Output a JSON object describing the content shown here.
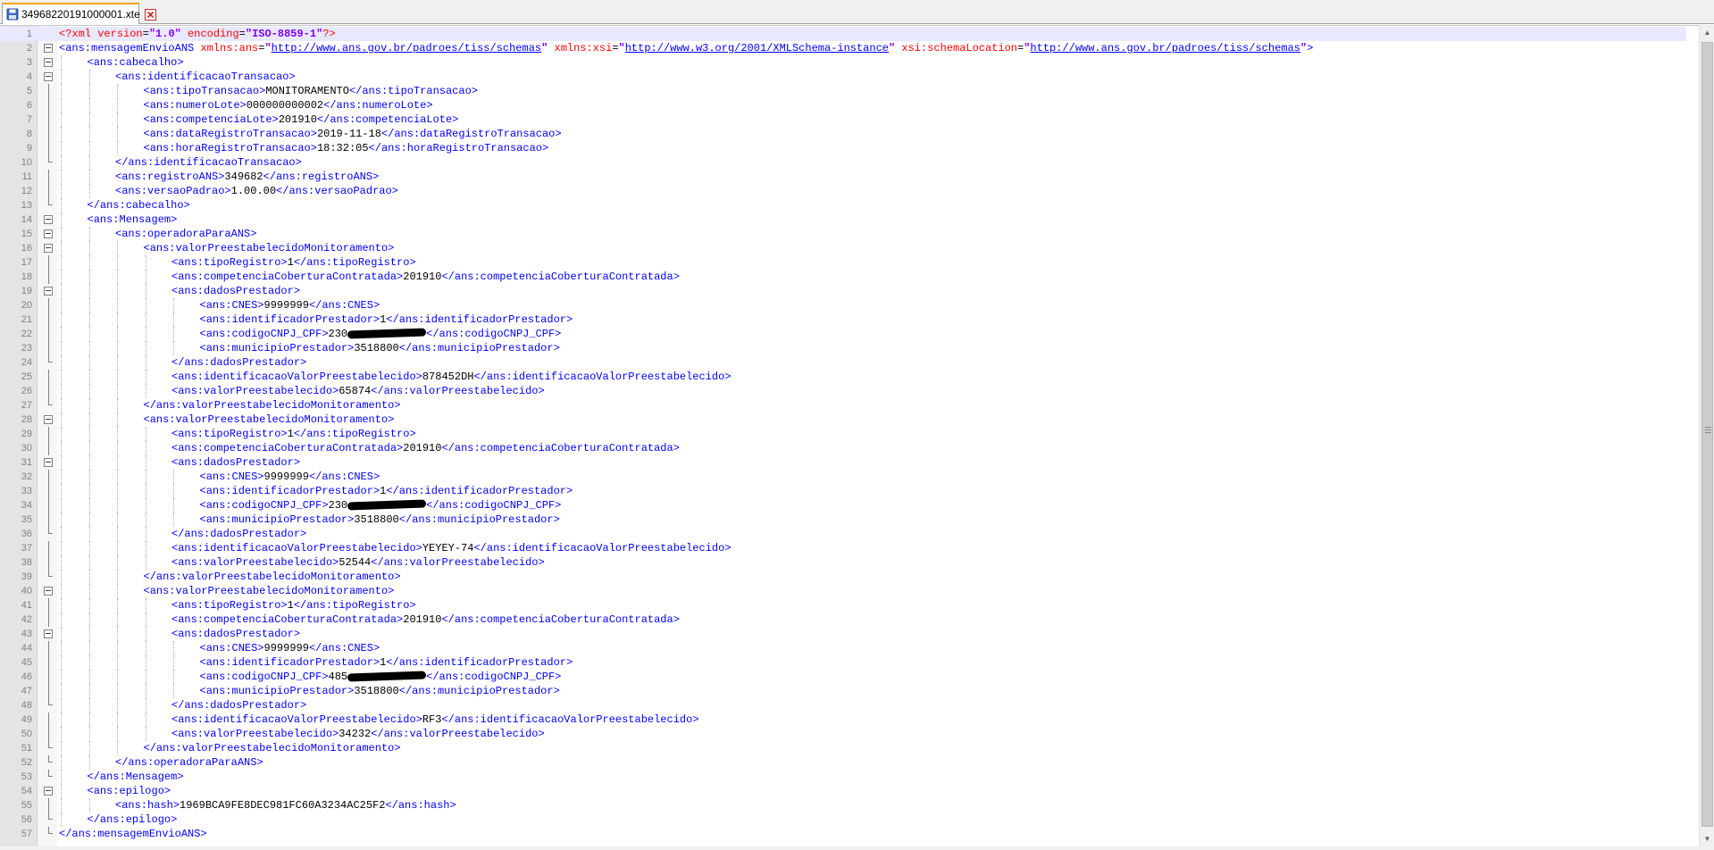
{
  "tab": {
    "filename": "34968220191000001.xte"
  },
  "current_line": 1,
  "lines": [
    {
      "n": "1",
      "indent": 0,
      "fold": "none",
      "segs": [
        [
          "p",
          "<?xml "
        ],
        [
          "a",
          "version"
        ],
        [
          "x",
          "="
        ],
        [
          "v",
          "\"1.0\""
        ],
        [
          "a",
          " encoding"
        ],
        [
          "x",
          "="
        ],
        [
          "v",
          "\"ISO-8859-1\""
        ],
        [
          "p",
          "?>"
        ]
      ]
    },
    {
      "n": "2",
      "indent": 0,
      "fold": "open",
      "segs": [
        [
          "t",
          "<ans:mensagemEnvioANS "
        ],
        [
          "a",
          "xmlns:ans"
        ],
        [
          "x",
          "="
        ],
        [
          "v",
          "\""
        ],
        [
          "u",
          "http://www.ans.gov.br/padroes/tiss/schemas"
        ],
        [
          "v",
          "\""
        ],
        [
          "a",
          " xmlns:xsi"
        ],
        [
          "x",
          "="
        ],
        [
          "v",
          "\""
        ],
        [
          "u",
          "http://www.w3.org/2001/XMLSchema-instance"
        ],
        [
          "v",
          "\""
        ],
        [
          "a",
          " xsi:schemaLocation"
        ],
        [
          "x",
          "="
        ],
        [
          "v",
          "\""
        ],
        [
          "u",
          "http://www.ans.gov.br/padroes/tiss/schemas"
        ],
        [
          "v",
          "\""
        ],
        [
          "t",
          ">"
        ]
      ]
    },
    {
      "n": "3",
      "indent": 1,
      "fold": "open",
      "segs": [
        [
          "t",
          "<ans:cabecalho>"
        ]
      ]
    },
    {
      "n": "4",
      "indent": 2,
      "fold": "open",
      "segs": [
        [
          "t",
          "<ans:identificacaoTransacao>"
        ]
      ]
    },
    {
      "n": "5",
      "indent": 3,
      "fold": "line",
      "segs": [
        [
          "t",
          "<ans:tipoTransacao>"
        ],
        [
          "x",
          "MONITORAMENTO"
        ],
        [
          "t",
          "</ans:tipoTransacao>"
        ]
      ]
    },
    {
      "n": "6",
      "indent": 3,
      "fold": "line",
      "segs": [
        [
          "t",
          "<ans:numeroLote>"
        ],
        [
          "x",
          "000000000002"
        ],
        [
          "t",
          "</ans:numeroLote>"
        ]
      ]
    },
    {
      "n": "7",
      "indent": 3,
      "fold": "line",
      "segs": [
        [
          "t",
          "<ans:competenciaLote>"
        ],
        [
          "x",
          "201910"
        ],
        [
          "t",
          "</ans:competenciaLote>"
        ]
      ]
    },
    {
      "n": "8",
      "indent": 3,
      "fold": "line",
      "segs": [
        [
          "t",
          "<ans:dataRegistroTransacao>"
        ],
        [
          "x",
          "2019-11-18"
        ],
        [
          "t",
          "</ans:dataRegistroTransacao>"
        ]
      ]
    },
    {
      "n": "9",
      "indent": 3,
      "fold": "line",
      "segs": [
        [
          "t",
          "<ans:horaRegistroTransacao>"
        ],
        [
          "x",
          "18:32:05"
        ],
        [
          "t",
          "</ans:horaRegistroTransacao>"
        ]
      ]
    },
    {
      "n": "10",
      "indent": 2,
      "fold": "end",
      "segs": [
        [
          "t",
          "</ans:identificacaoTransacao>"
        ]
      ]
    },
    {
      "n": "11",
      "indent": 2,
      "fold": "line",
      "segs": [
        [
          "t",
          "<ans:registroANS>"
        ],
        [
          "x",
          "349682"
        ],
        [
          "t",
          "</ans:registroANS>"
        ]
      ]
    },
    {
      "n": "12",
      "indent": 2,
      "fold": "line",
      "segs": [
        [
          "t",
          "<ans:versaoPadrao>"
        ],
        [
          "x",
          "1.00.00"
        ],
        [
          "t",
          "</ans:versaoPadrao>"
        ]
      ]
    },
    {
      "n": "13",
      "indent": 1,
      "fold": "end",
      "segs": [
        [
          "t",
          "</ans:cabecalho>"
        ]
      ]
    },
    {
      "n": "14",
      "indent": 1,
      "fold": "open",
      "segs": [
        [
          "t",
          "<ans:Mensagem>"
        ]
      ]
    },
    {
      "n": "15",
      "indent": 2,
      "fold": "open",
      "segs": [
        [
          "t",
          "<ans:operadoraParaANS>"
        ]
      ]
    },
    {
      "n": "16",
      "indent": 3,
      "fold": "open",
      "segs": [
        [
          "t",
          "<ans:valorPreestabelecidoMonitoramento>"
        ]
      ]
    },
    {
      "n": "17",
      "indent": 4,
      "fold": "line",
      "segs": [
        [
          "t",
          "<ans:tipoRegistro>"
        ],
        [
          "x",
          "1"
        ],
        [
          "t",
          "</ans:tipoRegistro>"
        ]
      ]
    },
    {
      "n": "18",
      "indent": 4,
      "fold": "line",
      "segs": [
        [
          "t",
          "<ans:competenciaCoberturaContratada>"
        ],
        [
          "x",
          "201910"
        ],
        [
          "t",
          "</ans:competenciaCoberturaContratada>"
        ]
      ]
    },
    {
      "n": "19",
      "indent": 4,
      "fold": "open",
      "segs": [
        [
          "t",
          "<ans:dadosPrestador>"
        ]
      ]
    },
    {
      "n": "20",
      "indent": 5,
      "fold": "line",
      "segs": [
        [
          "t",
          "<ans:CNES>"
        ],
        [
          "x",
          "9999999"
        ],
        [
          "t",
          "</ans:CNES>"
        ]
      ]
    },
    {
      "n": "21",
      "indent": 5,
      "fold": "line",
      "segs": [
        [
          "t",
          "<ans:identificadorPrestador>"
        ],
        [
          "x",
          "1"
        ],
        [
          "t",
          "</ans:identificadorPrestador>"
        ]
      ]
    },
    {
      "n": "22",
      "indent": 5,
      "fold": "line",
      "segs": [
        [
          "t",
          "<ans:codigoCNPJ_CPF>"
        ],
        [
          "x",
          "230"
        ],
        [
          "r",
          ""
        ],
        [
          "t",
          "</ans:codigoCNPJ_CPF>"
        ]
      ]
    },
    {
      "n": "23",
      "indent": 5,
      "fold": "line",
      "segs": [
        [
          "t",
          "<ans:municipioPrestador>"
        ],
        [
          "x",
          "3518800"
        ],
        [
          "t",
          "</ans:municipioPrestador>"
        ]
      ]
    },
    {
      "n": "24",
      "indent": 4,
      "fold": "end",
      "segs": [
        [
          "t",
          "</ans:dadosPrestador>"
        ]
      ]
    },
    {
      "n": "25",
      "indent": 4,
      "fold": "line",
      "segs": [
        [
          "t",
          "<ans:identificacaoValorPreestabelecido>"
        ],
        [
          "x",
          "878452DH"
        ],
        [
          "t",
          "</ans:identificacaoValorPreestabelecido>"
        ]
      ]
    },
    {
      "n": "26",
      "indent": 4,
      "fold": "line",
      "segs": [
        [
          "t",
          "<ans:valorPreestabelecido>"
        ],
        [
          "x",
          "65874"
        ],
        [
          "t",
          "</ans:valorPreestabelecido>"
        ]
      ]
    },
    {
      "n": "27",
      "indent": 3,
      "fold": "end",
      "segs": [
        [
          "t",
          "</ans:valorPreestabelecidoMonitoramento>"
        ]
      ]
    },
    {
      "n": "28",
      "indent": 3,
      "fold": "open",
      "segs": [
        [
          "t",
          "<ans:valorPreestabelecidoMonitoramento>"
        ]
      ]
    },
    {
      "n": "29",
      "indent": 4,
      "fold": "line",
      "segs": [
        [
          "t",
          "<ans:tipoRegistro>"
        ],
        [
          "x",
          "1"
        ],
        [
          "t",
          "</ans:tipoRegistro>"
        ]
      ]
    },
    {
      "n": "30",
      "indent": 4,
      "fold": "line",
      "segs": [
        [
          "t",
          "<ans:competenciaCoberturaContratada>"
        ],
        [
          "x",
          "201910"
        ],
        [
          "t",
          "</ans:competenciaCoberturaContratada>"
        ]
      ]
    },
    {
      "n": "31",
      "indent": 4,
      "fold": "open",
      "segs": [
        [
          "t",
          "<ans:dadosPrestador>"
        ]
      ]
    },
    {
      "n": "32",
      "indent": 5,
      "fold": "line",
      "segs": [
        [
          "t",
          "<ans:CNES>"
        ],
        [
          "x",
          "9999999"
        ],
        [
          "t",
          "</ans:CNES>"
        ]
      ]
    },
    {
      "n": "33",
      "indent": 5,
      "fold": "line",
      "segs": [
        [
          "t",
          "<ans:identificadorPrestador>"
        ],
        [
          "x",
          "1"
        ],
        [
          "t",
          "</ans:identificadorPrestador>"
        ]
      ]
    },
    {
      "n": "34",
      "indent": 5,
      "fold": "line",
      "segs": [
        [
          "t",
          "<ans:codigoCNPJ_CPF>"
        ],
        [
          "x",
          "230"
        ],
        [
          "r",
          ""
        ],
        [
          "t",
          "</ans:codigoCNPJ_CPF>"
        ]
      ]
    },
    {
      "n": "35",
      "indent": 5,
      "fold": "line",
      "segs": [
        [
          "t",
          "<ans:municipioPrestador>"
        ],
        [
          "x",
          "3518800"
        ],
        [
          "t",
          "</ans:municipioPrestador>"
        ]
      ]
    },
    {
      "n": "36",
      "indent": 4,
      "fold": "end",
      "segs": [
        [
          "t",
          "</ans:dadosPrestador>"
        ]
      ]
    },
    {
      "n": "37",
      "indent": 4,
      "fold": "line",
      "segs": [
        [
          "t",
          "<ans:identificacaoValorPreestabelecido>"
        ],
        [
          "x",
          "YEYEY-74"
        ],
        [
          "t",
          "</ans:identificacaoValorPreestabelecido>"
        ]
      ]
    },
    {
      "n": "38",
      "indent": 4,
      "fold": "line",
      "segs": [
        [
          "t",
          "<ans:valorPreestabelecido>"
        ],
        [
          "x",
          "52544"
        ],
        [
          "t",
          "</ans:valorPreestabelecido>"
        ]
      ]
    },
    {
      "n": "39",
      "indent": 3,
      "fold": "end",
      "segs": [
        [
          "t",
          "</ans:valorPreestabelecidoMonitoramento>"
        ]
      ]
    },
    {
      "n": "40",
      "indent": 3,
      "fold": "open",
      "segs": [
        [
          "t",
          "<ans:valorPreestabelecidoMonitoramento>"
        ]
      ]
    },
    {
      "n": "41",
      "indent": 4,
      "fold": "line",
      "segs": [
        [
          "t",
          "<ans:tipoRegistro>"
        ],
        [
          "x",
          "1"
        ],
        [
          "t",
          "</ans:tipoRegistro>"
        ]
      ]
    },
    {
      "n": "42",
      "indent": 4,
      "fold": "line",
      "segs": [
        [
          "t",
          "<ans:competenciaCoberturaContratada>"
        ],
        [
          "x",
          "201910"
        ],
        [
          "t",
          "</ans:competenciaCoberturaContratada>"
        ]
      ]
    },
    {
      "n": "43",
      "indent": 4,
      "fold": "open",
      "segs": [
        [
          "t",
          "<ans:dadosPrestador>"
        ]
      ]
    },
    {
      "n": "44",
      "indent": 5,
      "fold": "line",
      "segs": [
        [
          "t",
          "<ans:CNES>"
        ],
        [
          "x",
          "9999999"
        ],
        [
          "t",
          "</ans:CNES>"
        ]
      ]
    },
    {
      "n": "45",
      "indent": 5,
      "fold": "line",
      "segs": [
        [
          "t",
          "<ans:identificadorPrestador>"
        ],
        [
          "x",
          "1"
        ],
        [
          "t",
          "</ans:identificadorPrestador>"
        ]
      ]
    },
    {
      "n": "46",
      "indent": 5,
      "fold": "line",
      "segs": [
        [
          "t",
          "<ans:codigoCNPJ_CPF>"
        ],
        [
          "x",
          "485"
        ],
        [
          "r",
          ""
        ],
        [
          "t",
          "</ans:codigoCNPJ_CPF>"
        ]
      ]
    },
    {
      "n": "47",
      "indent": 5,
      "fold": "line",
      "segs": [
        [
          "t",
          "<ans:municipioPrestador>"
        ],
        [
          "x",
          "3518800"
        ],
        [
          "t",
          "</ans:municipioPrestador>"
        ]
      ]
    },
    {
      "n": "48",
      "indent": 4,
      "fold": "end",
      "segs": [
        [
          "t",
          "</ans:dadosPrestador>"
        ]
      ]
    },
    {
      "n": "49",
      "indent": 4,
      "fold": "line",
      "segs": [
        [
          "t",
          "<ans:identificacaoValorPreestabelecido>"
        ],
        [
          "x",
          "RF3"
        ],
        [
          "t",
          "</ans:identificacaoValorPreestabelecido>"
        ]
      ]
    },
    {
      "n": "50",
      "indent": 4,
      "fold": "line",
      "segs": [
        [
          "t",
          "<ans:valorPreestabelecido>"
        ],
        [
          "x",
          "34232"
        ],
        [
          "t",
          "</ans:valorPreestabelecido>"
        ]
      ]
    },
    {
      "n": "51",
      "indent": 3,
      "fold": "end",
      "segs": [
        [
          "t",
          "</ans:valorPreestabelecidoMonitoramento>"
        ]
      ]
    },
    {
      "n": "52",
      "indent": 2,
      "fold": "end",
      "segs": [
        [
          "t",
          "</ans:operadoraParaANS>"
        ]
      ]
    },
    {
      "n": "53",
      "indent": 1,
      "fold": "end",
      "segs": [
        [
          "t",
          "</ans:Mensagem>"
        ]
      ]
    },
    {
      "n": "54",
      "indent": 1,
      "fold": "open",
      "segs": [
        [
          "t",
          "<ans:epilogo>"
        ]
      ]
    },
    {
      "n": "55",
      "indent": 2,
      "fold": "line",
      "segs": [
        [
          "t",
          "<ans:hash>"
        ],
        [
          "x",
          "1969BCA9FE8DEC981FC60A3234AC25F2"
        ],
        [
          "t",
          "</ans:hash>"
        ]
      ]
    },
    {
      "n": "56",
      "indent": 1,
      "fold": "end",
      "segs": [
        [
          "t",
          "</ans:epilogo>"
        ]
      ]
    },
    {
      "n": "57",
      "indent": 0,
      "fold": "end",
      "segs": [
        [
          "t",
          "</ans:mensagemEnvioANS>"
        ]
      ]
    }
  ],
  "colors": {
    "tag": "#0000ff",
    "attribute": "#ff0000",
    "attribute_value": "#8000ff",
    "text": "#000000",
    "tab_accent": "#f4a41c",
    "current_line": "#e8e8ff"
  },
  "icons": {
    "tab_file": "save-disk-icon",
    "tab_close": "close-icon"
  }
}
